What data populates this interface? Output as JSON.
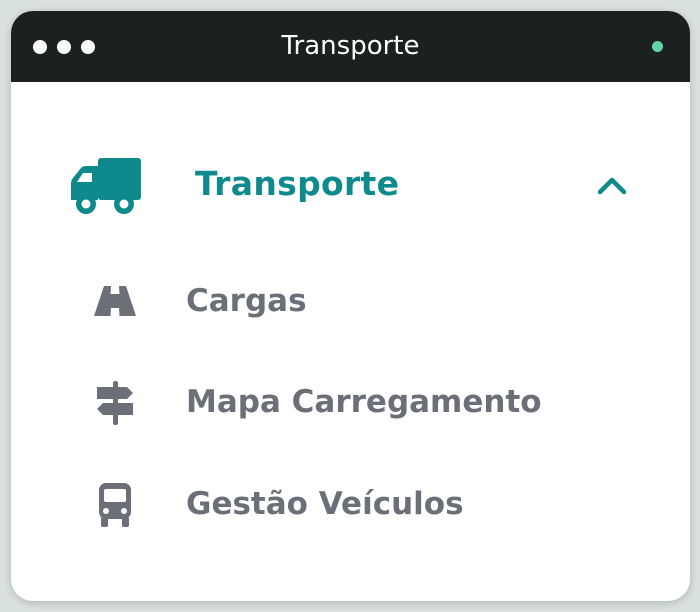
{
  "window": {
    "title": "Transporte",
    "status_color": "#5fd6a4"
  },
  "menu": {
    "header": {
      "label": "Transporte",
      "icon": "truck-icon",
      "expanded": true,
      "color": "#0e8a8c"
    },
    "items": [
      {
        "label": "Cargas",
        "icon": "road-icon"
      },
      {
        "label": "Mapa Carregamento",
        "icon": "signpost-icon"
      },
      {
        "label": "Gestão Veículos",
        "icon": "bus-icon"
      }
    ],
    "item_color": "#6b6f78"
  }
}
